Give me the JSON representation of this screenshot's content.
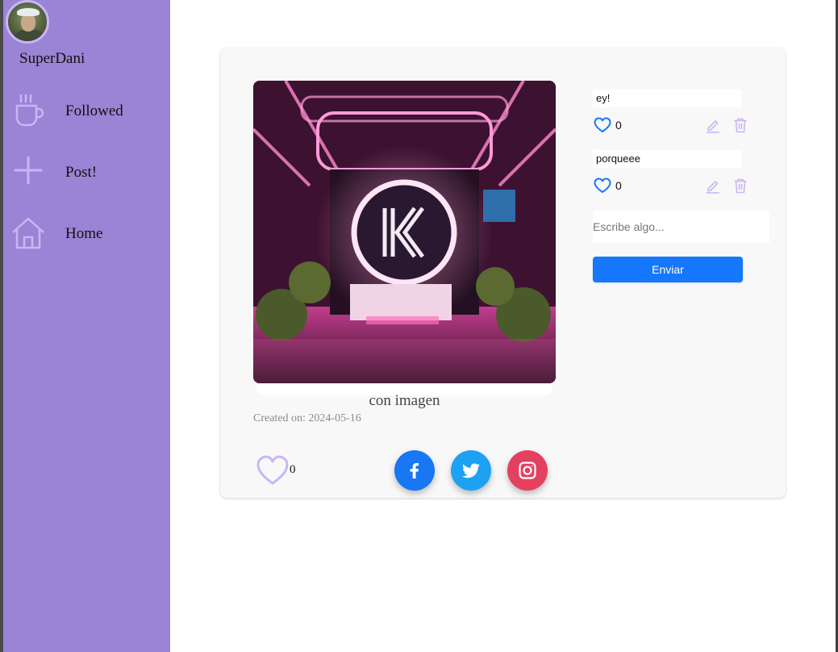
{
  "user": {
    "username": "SuperDani",
    "avatar_icon": "user-avatar"
  },
  "sidebar": {
    "items": [
      {
        "label": "Followed",
        "icon": "coffee-cup-icon"
      },
      {
        "label": "Post!",
        "icon": "plus-icon"
      },
      {
        "label": "Home",
        "icon": "home-icon"
      }
    ]
  },
  "post": {
    "caption": "con imagen",
    "created": "Created on: 2024-05-16",
    "likes": "0",
    "share": [
      {
        "name": "facebook",
        "color": "#1877f2"
      },
      {
        "name": "twitter",
        "color": "#1da1f2"
      },
      {
        "name": "instagram",
        "color": "#e4405f"
      }
    ]
  },
  "comments": [
    {
      "text": "ey!",
      "likes": "0"
    },
    {
      "text": "porqueee",
      "likes": "0"
    }
  ],
  "comment_form": {
    "placeholder": "Escribe algo...",
    "submit_label": "Enviar"
  },
  "colors": {
    "sidebar": "#9b83d6",
    "icon_accent": "#c9b6f3",
    "primary": "#1677ff",
    "heart_blue": "#1677ff"
  }
}
